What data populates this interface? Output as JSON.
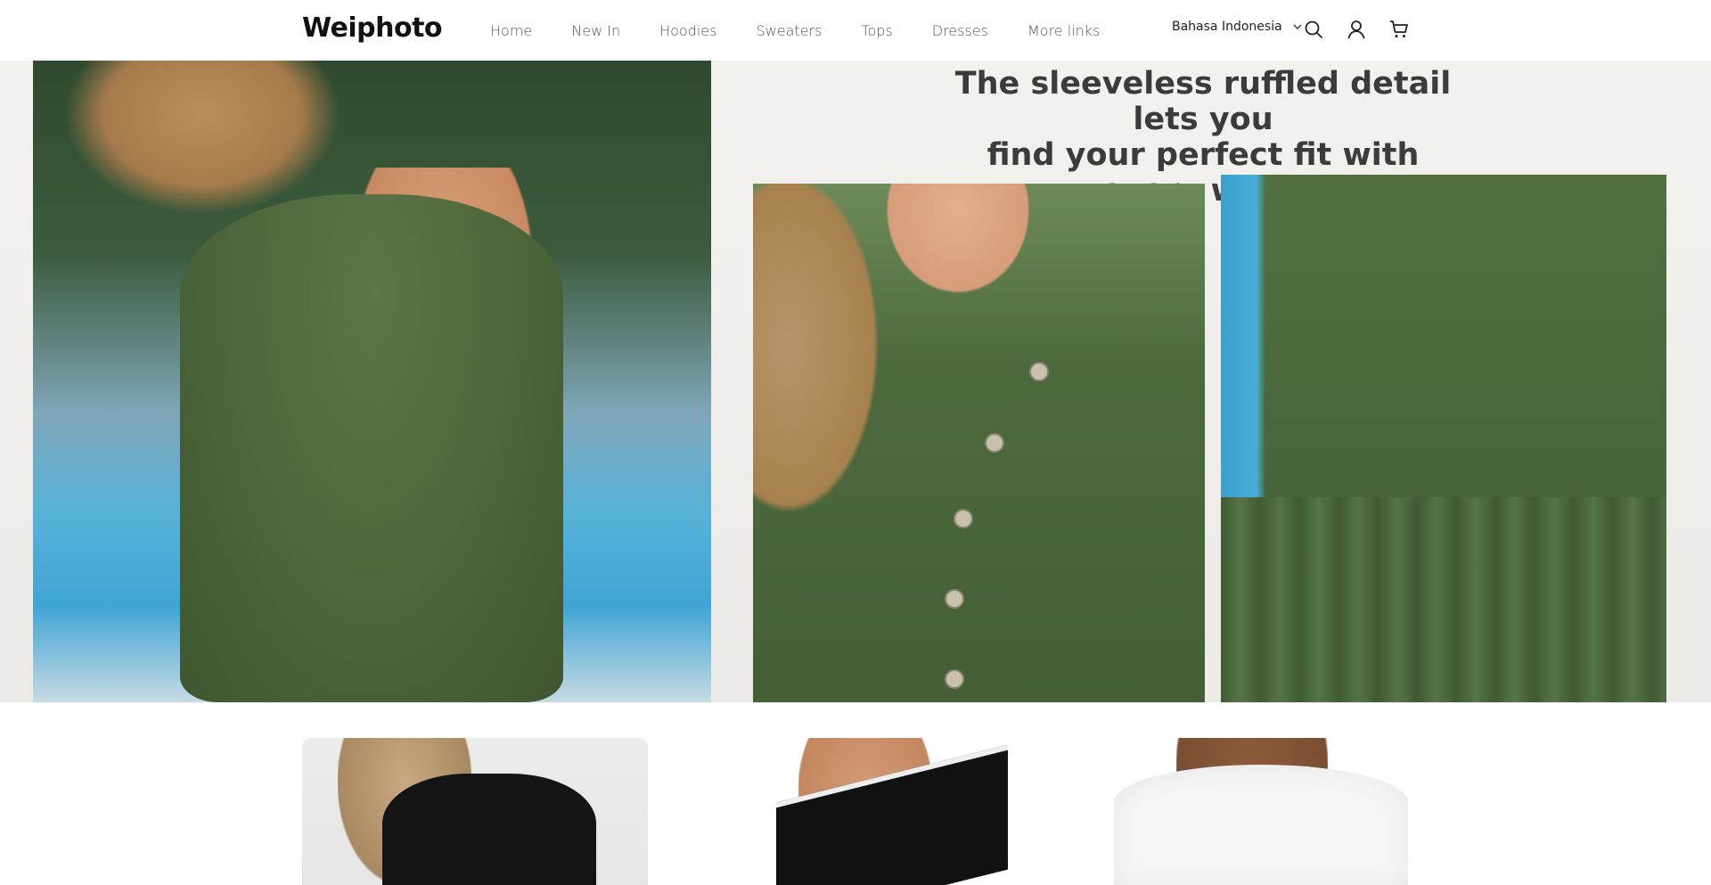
{
  "header": {
    "logo": "Weiphoto",
    "nav": [
      "Home",
      "New In",
      "Hoodies",
      "Sweaters",
      "Tops",
      "Dresses",
      "More links"
    ],
    "language": "Bahasa Indonesia",
    "icons": [
      "search-icon",
      "account-icon",
      "cart-icon"
    ]
  },
  "hero": {
    "tagline_line1": "The sleeveless ruffled detail lets you",
    "tagline_line2": "find your perfect fit with every wear."
  },
  "colors": {
    "dress_green": "#4b6439",
    "header_bg": "#ffffff",
    "nav_text": "#555555"
  }
}
